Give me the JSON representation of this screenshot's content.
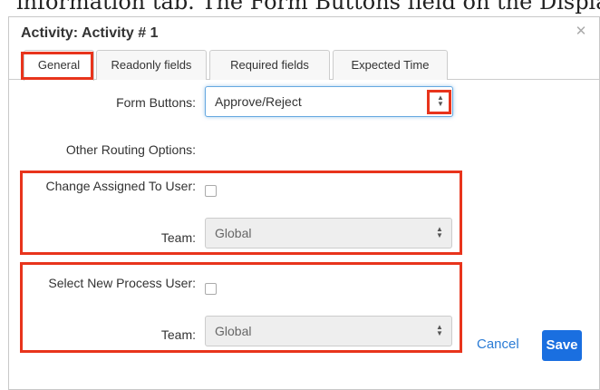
{
  "background_caption": "information tab. The Form Buttons field on the Display only does the",
  "dialog": {
    "title": "Activity: Activity # 1",
    "close_glyph": "✕"
  },
  "tabs": [
    {
      "label": "General",
      "active": true
    },
    {
      "label": "Readonly fields",
      "active": false
    },
    {
      "label": "Required fields",
      "active": false
    },
    {
      "label": "Expected Time",
      "active": false
    }
  ],
  "form": {
    "form_buttons_label": "Form Buttons:",
    "form_buttons_value": "Approve/Reject",
    "other_routing_label": "Other Routing Options:",
    "change_assigned_label": "Change Assigned To User:",
    "change_assigned_checked": false,
    "team1_label": "Team:",
    "team1_value": "Global",
    "select_new_label": "Select New Process User:",
    "select_new_checked": false,
    "team2_label": "Team:",
    "team2_value": "Global"
  },
  "footer": {
    "cancel_label": "Cancel",
    "save_label": "Save"
  },
  "colors": {
    "highlight": "#e8341c",
    "primary_button": "#1a6fe0",
    "link": "#2a7bd5"
  }
}
